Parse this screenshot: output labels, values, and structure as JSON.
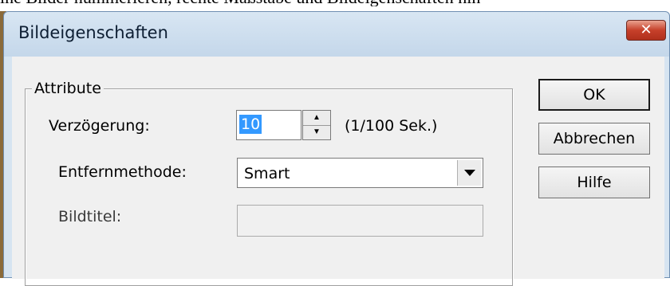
{
  "background": {
    "caption": "ine Bilder nummerieren, rechte Maßstäbe und Bildeigenschaften hin"
  },
  "dialog": {
    "title": "Bildeigenschaften",
    "close_glyph": "✕",
    "group_label": "Attribute",
    "fields": {
      "delay": {
        "label": "Verzögerung:",
        "value": "10",
        "unit": "(1/100 Sek.)"
      },
      "removal_method": {
        "label": "Entfernmethode:",
        "selected": "Smart"
      },
      "image_title": {
        "label": "Bildtitel:",
        "value": ""
      }
    },
    "buttons": {
      "ok": "OK",
      "cancel": "Abbrechen",
      "help": "Hilfe"
    }
  },
  "colors": {
    "titlebar": "#c4d7ea",
    "close_button": "#c6402a",
    "selection": "#3399ff",
    "client_bg": "#f0f0f0"
  },
  "icons": {
    "close": "close-icon",
    "spin_up": "spin-up-icon",
    "spin_down": "spin-down-icon",
    "dropdown": "chevron-down-icon"
  }
}
